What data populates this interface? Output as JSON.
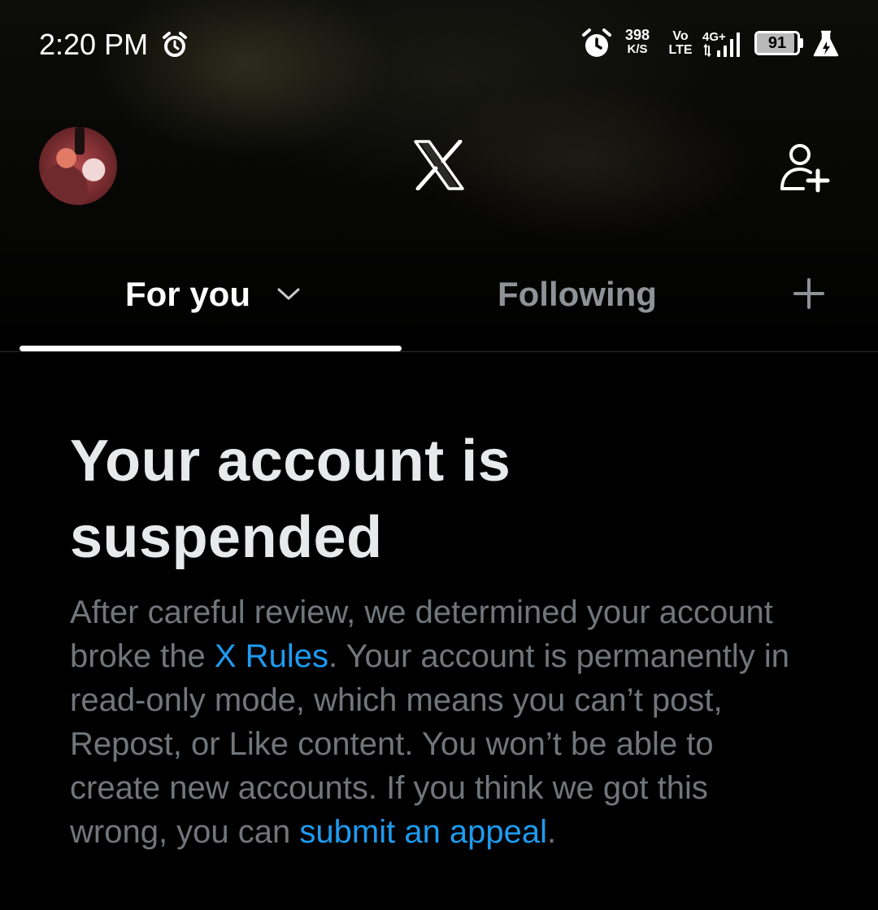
{
  "status_bar": {
    "time": "2:20 PM",
    "net_speed_value": "398",
    "net_speed_unit": "K/S",
    "volte_top": "Vo",
    "volte_bottom": "LTE",
    "network": "4G+",
    "battery_level": "91",
    "battery_fraction": 0.91,
    "icons": [
      "alarm-icon",
      "alarm-icon",
      "signal-icon",
      "battery-icon",
      "flask-icon"
    ]
  },
  "header": {
    "logo": "x-logo",
    "avatar": "profile-avatar",
    "right_action_icon": "add-user-icon"
  },
  "tabs": {
    "items": [
      {
        "label": "For you",
        "active": true
      },
      {
        "label": "Following",
        "active": false
      }
    ],
    "add_icon": "plus-icon"
  },
  "suspension": {
    "heading": "Your account is suspended",
    "body_part1": "After careful review, we determined your account broke the ",
    "rules_link": "X Rules",
    "body_part2": ". Your account is permanently in read-only mode, which means you can’t post, Repost, or Like content. You won’t be able to create new accounts. If you think we got this wrong, you can ",
    "appeal_link": "submit an appeal",
    "body_part3": "."
  },
  "colors": {
    "background": "#000000",
    "heading": "#e7e9ea",
    "body": "#71767b",
    "link": "#1d9bf0",
    "inactive_tab": "#8f9296"
  }
}
